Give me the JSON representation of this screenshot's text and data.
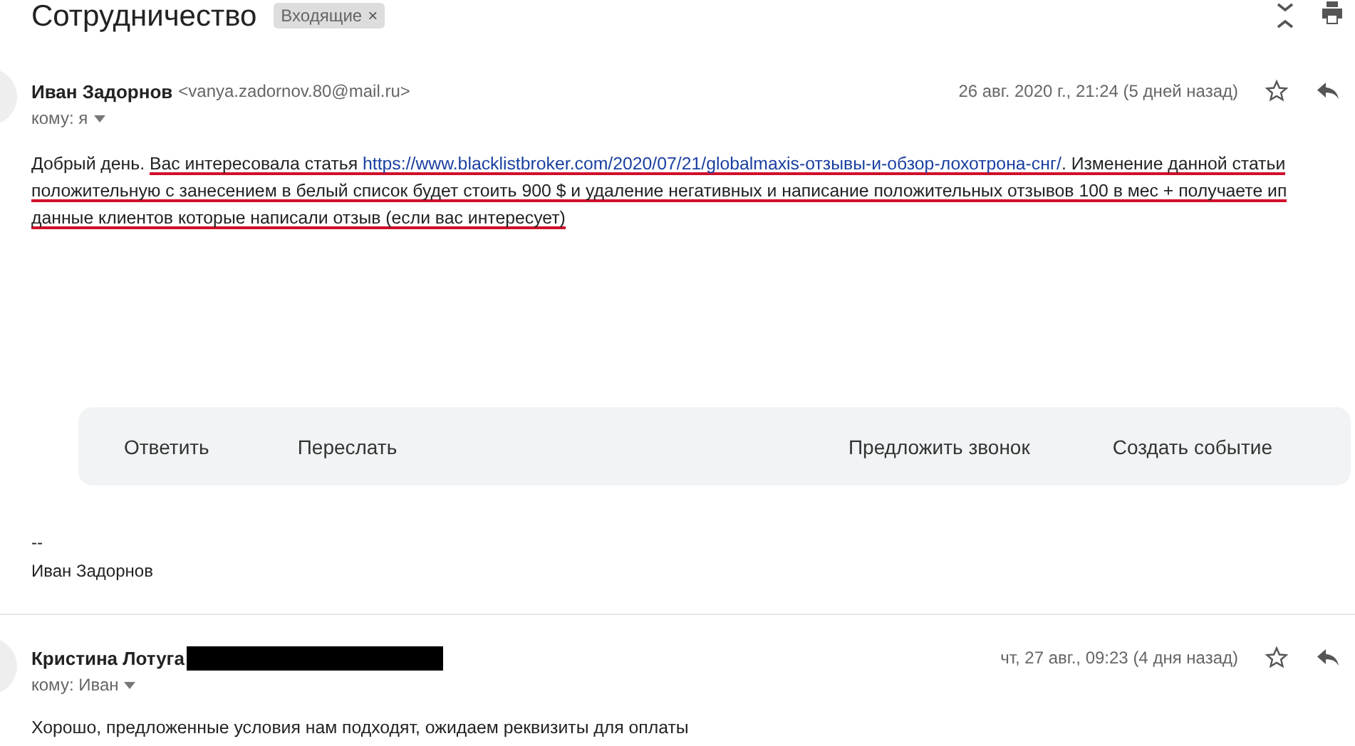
{
  "thread": {
    "title": "Сотрудничество",
    "label": "Входящие",
    "label_close": "×"
  },
  "messages": [
    {
      "sender": "Иван Задорнов",
      "email": "<vanya.zadornov.80@mail.ru>",
      "redacted": false,
      "date": "26 авг. 2020 г., 21:24 (5 дней назад)",
      "to": "кому: я",
      "body": [
        {
          "kind": "text",
          "text": "Добрый день. ",
          "marked": false
        },
        {
          "kind": "text",
          "text": "Вас интересовала статья ",
          "marked": true
        },
        {
          "kind": "link",
          "text": "https://www.blacklistbroker.com/2020/07/21/globalmaxis-отзывы-и-обзор-лохотрона-снг/",
          "marked": true
        },
        {
          "kind": "text",
          "text": ". Изменение данной статьи положительную с занесением в белый список будет стоить 900 $ и удаление негативных и написание положительных отзывов 100 в мес + получаете ип данные клиентов которые написали отзыв (если вас интересует)",
          "marked": true
        }
      ],
      "actions": [
        "Ответить",
        "Переслать",
        "Предложить звонок",
        "Создать событие"
      ],
      "signature": [
        "--",
        "Иван Задорнов"
      ]
    },
    {
      "sender": "Кристина Лотуга",
      "redacted": true,
      "date": "чт, 27 авг., 09:23 (4 дня назад)",
      "to": "кому: Иван",
      "body": [
        {
          "kind": "text",
          "text": "Хорошо, предложенные условия нам подходят, ожидаем реквизиты для оплаты",
          "marked": false
        }
      ]
    }
  ]
}
